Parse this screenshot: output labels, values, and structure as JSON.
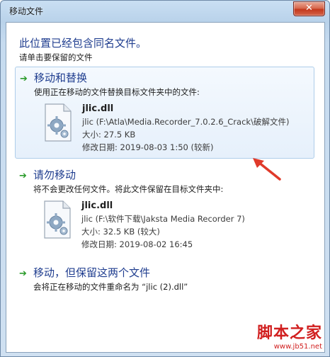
{
  "window": {
    "title": "移动文件",
    "close_glyph": "✕"
  },
  "dialog": {
    "heading": "此位置已经包含同名文件。",
    "subheading": "请单击要保留的文件"
  },
  "options": [
    {
      "title": "移动和替换",
      "description": "使用正在移动的文件替换目标文件夹中的文件:",
      "file": {
        "name": "jlic.dll",
        "path": "jlic (F:\\Atla\\Media.Recorder_7.0.2.6_Crack\\破解文件)",
        "size": "大小: 27.5 KB",
        "modified": "修改日期: 2019-08-03 1:50 (较新)"
      }
    },
    {
      "title": "请勿移动",
      "description": "将不会更改任何文件。将此文件保留在目标文件夹中:",
      "file": {
        "name": "jlic.dll",
        "path": "jlic (F:\\软件下载\\Jaksta Media Recorder 7)",
        "size": "大小: 32.5 KB (较大)",
        "modified": "修改日期: 2019-08-02 16:45"
      }
    },
    {
      "title": "移动，但保留这两个文件",
      "description": "会将正在移动的文件重命名为 “jlic (2).dll”"
    }
  ],
  "icons": {
    "arrow": "green-arrow-icon",
    "file": "dll-file-gear-icon"
  },
  "colors": {
    "accent_blue": "#1f3d8f",
    "green_arrow": "#2b9b2b",
    "annotation_red": "#e03a2a"
  },
  "watermark": {
    "main": "脚本之家",
    "sub": "www.jb51.net"
  }
}
